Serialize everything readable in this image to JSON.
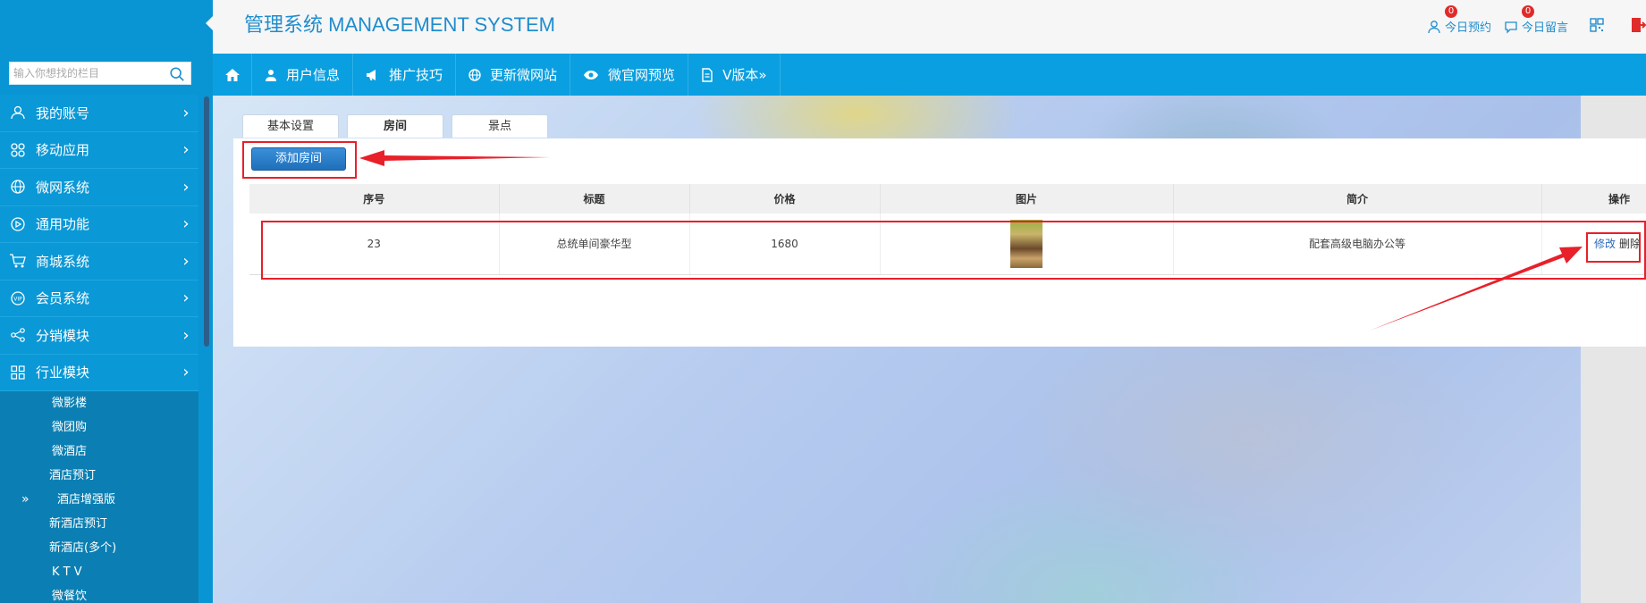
{
  "header": {
    "title": "管理系统 MANAGEMENT SYSTEM",
    "links": [
      {
        "label": "今日预约",
        "badge": "0"
      },
      {
        "label": "今日留言",
        "badge": "0"
      }
    ]
  },
  "search": {
    "placeholder": "输入你想找的栏目"
  },
  "sidebar": {
    "items": [
      {
        "label": "我的账号"
      },
      {
        "label": "移动应用"
      },
      {
        "label": "微网系统"
      },
      {
        "label": "通用功能"
      },
      {
        "label": "商城系统"
      },
      {
        "label": "会员系统"
      },
      {
        "label": "分销模块"
      },
      {
        "label": "行业模块"
      }
    ],
    "chevron": "›",
    "submenu": [
      {
        "label": "微影楼"
      },
      {
        "label": "微团购"
      },
      {
        "label": "微酒店"
      },
      {
        "label": "酒店预订"
      },
      {
        "label": "酒店增强版"
      },
      {
        "label": "新酒店预订"
      },
      {
        "label": "新酒店(多个)"
      },
      {
        "label": "K T V"
      },
      {
        "label": "微餐饮"
      }
    ],
    "active_marker": "»"
  },
  "topnav": {
    "items": [
      {
        "label": "用户信息"
      },
      {
        "label": "推广技巧"
      },
      {
        "label": "更新微网站"
      },
      {
        "label": "微官网预览"
      },
      {
        "label": "V版本»"
      }
    ]
  },
  "tabs": [
    {
      "label": "基本设置"
    },
    {
      "label": "房间"
    },
    {
      "label": "景点"
    }
  ],
  "panel": {
    "add_button": "添加房间",
    "table": {
      "headers": [
        "序号",
        "标题",
        "价格",
        "图片",
        "简介",
        "操作"
      ],
      "rows": [
        {
          "id": "23",
          "title": "总统单间豪华型",
          "price": "1680",
          "intro": "配套高级电脑办公等",
          "edit": "修改",
          "delete": "删除"
        }
      ]
    }
  },
  "colors": {
    "sidebar": "#0995d3",
    "topnav": "#0a9fe0",
    "accent": "#1f8dcd",
    "annotation": "#e8202a"
  }
}
